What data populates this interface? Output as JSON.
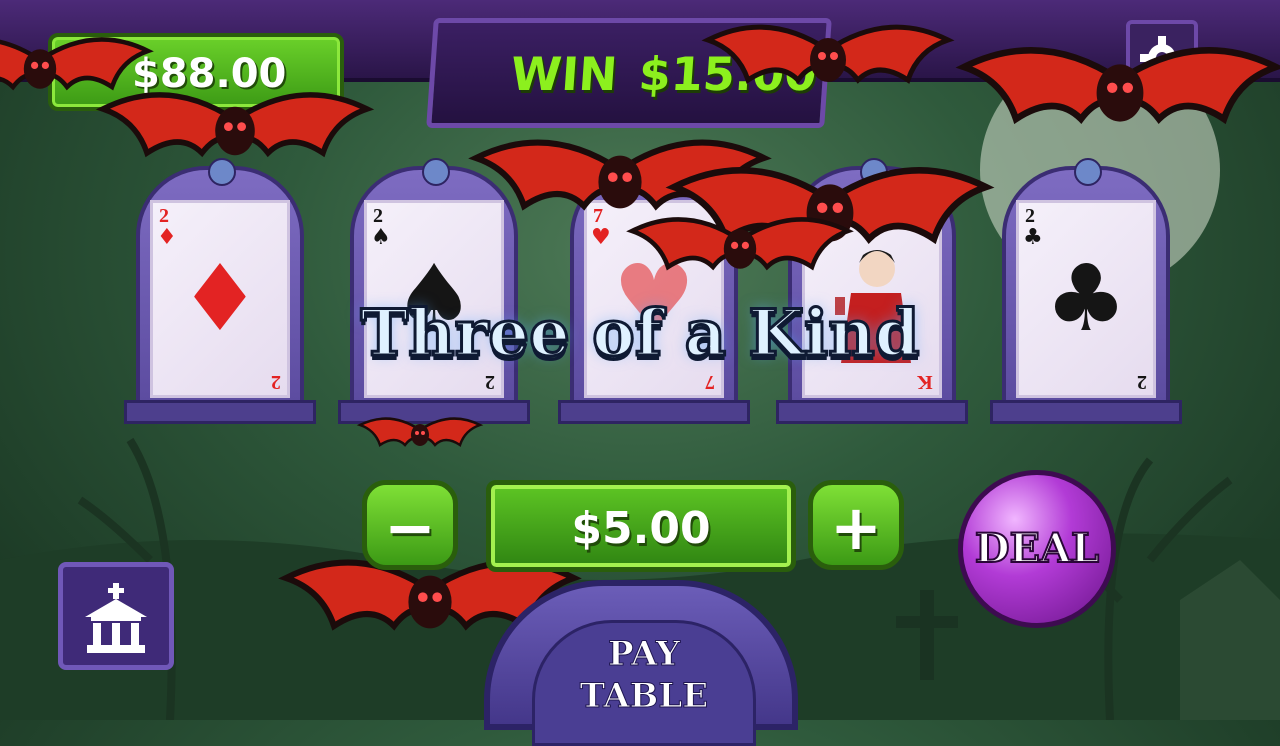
{
  "header": {
    "balance": "$88.00",
    "win_label": "WIN",
    "win_amount": "$15.00",
    "settings_icon": "gear-icon"
  },
  "hand": [
    {
      "rank": "2",
      "suit": "♦",
      "color": "red"
    },
    {
      "rank": "2",
      "suit": "♠",
      "color": "black"
    },
    {
      "rank": "7",
      "suit": "♥",
      "color": "red"
    },
    {
      "rank": "K",
      "suit": "♥",
      "color": "red",
      "face": "vampire"
    },
    {
      "rank": "2",
      "suit": "♣",
      "color": "black"
    }
  ],
  "result_banner": "Three of a Kind",
  "bet": {
    "minus_label": "−",
    "amount": "$5.00",
    "plus_label": "+"
  },
  "deal_label": "DEAL",
  "home_icon": "chapel-icon",
  "paytable": {
    "line1": "PAY",
    "line2": "TABLE"
  },
  "colors": {
    "accent_green": "#6bd12a",
    "purple": "#4c2a78",
    "win_text": "#8cf01e"
  }
}
